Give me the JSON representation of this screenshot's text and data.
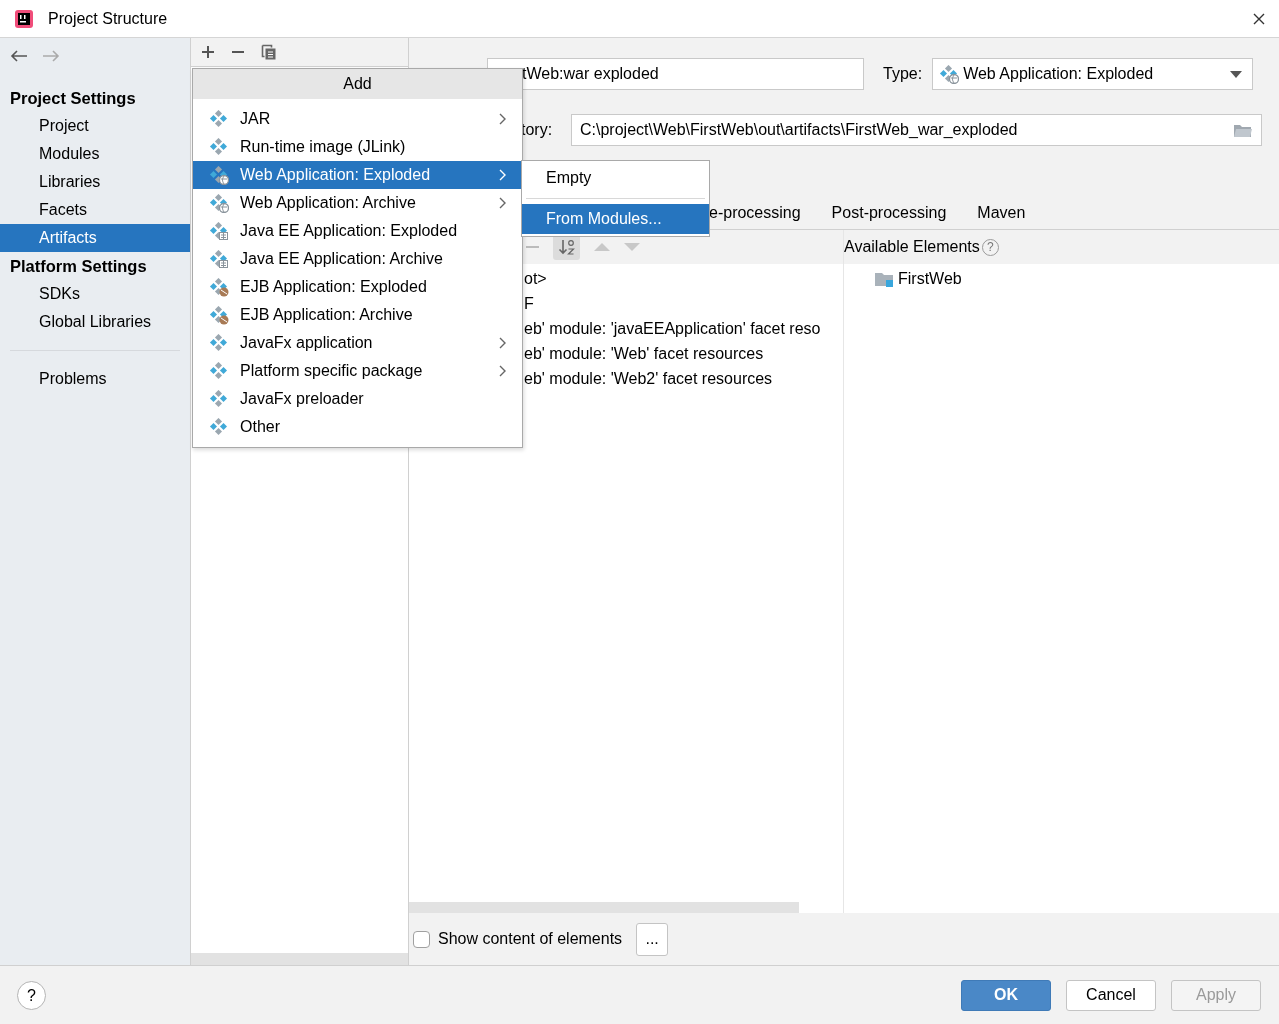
{
  "window": {
    "title": "Project Structure"
  },
  "sidebar": {
    "sections": [
      {
        "heading": "Project Settings",
        "items": [
          {
            "label": "Project",
            "selected": false
          },
          {
            "label": "Modules",
            "selected": false
          },
          {
            "label": "Libraries",
            "selected": false
          },
          {
            "label": "Facets",
            "selected": false
          },
          {
            "label": "Artifacts",
            "selected": true
          }
        ]
      },
      {
        "heading": "Platform Settings",
        "items": [
          {
            "label": "SDKs",
            "selected": false
          },
          {
            "label": "Global Libraries",
            "selected": false
          }
        ]
      }
    ],
    "extra_items": [
      {
        "label": "Problems",
        "selected": false
      }
    ]
  },
  "artifact": {
    "name_value": "tWeb:war exploded",
    "type_label": "Type:",
    "type_value": "Web Application: Exploded",
    "output_label": "tory:",
    "output_value": "C:\\project\\Web\\FirstWeb\\out\\artifacts\\FirstWeb_war_exploded"
  },
  "tabs": [
    {
      "label": "e-processing"
    },
    {
      "label": "Post-processing"
    },
    {
      "label": "Maven"
    }
  ],
  "output_tree": [
    "ot>",
    "F",
    "eb' module: 'javaEEApplication' facet reso",
    "eb' module: 'Web' facet resources",
    "eb' module: 'Web2' facet resources"
  ],
  "available_elements": {
    "title": "Available Elements",
    "help": "?",
    "items": [
      {
        "label": "FirstWeb"
      }
    ]
  },
  "show_content": {
    "label": "Show content of elements",
    "checked": false
  },
  "more_button": "...",
  "add_menu": {
    "title": "Add",
    "items": [
      {
        "label": "JAR",
        "kind": "plain",
        "has_submenu": true,
        "selected": false
      },
      {
        "label": "Run-time image (JLink)",
        "kind": "plain",
        "has_submenu": false,
        "selected": false
      },
      {
        "label": "Web Application: Exploded",
        "kind": "web",
        "has_submenu": true,
        "selected": true
      },
      {
        "label": "Web Application: Archive",
        "kind": "web",
        "has_submenu": true,
        "selected": false
      },
      {
        "label": "Java EE Application: Exploded",
        "kind": "ee",
        "has_submenu": false,
        "selected": false
      },
      {
        "label": "Java EE Application: Archive",
        "kind": "ee",
        "has_submenu": false,
        "selected": false
      },
      {
        "label": "EJB Application: Exploded",
        "kind": "ejb",
        "has_submenu": false,
        "selected": false
      },
      {
        "label": "EJB Application: Archive",
        "kind": "ejb",
        "has_submenu": false,
        "selected": false
      },
      {
        "label": "JavaFx application",
        "kind": "plain",
        "has_submenu": true,
        "selected": false
      },
      {
        "label": "Platform specific package",
        "kind": "plain",
        "has_submenu": true,
        "selected": false
      },
      {
        "label": "JavaFx preloader",
        "kind": "plain",
        "has_submenu": false,
        "selected": false
      },
      {
        "label": "Other",
        "kind": "plain",
        "has_submenu": false,
        "selected": false
      }
    ]
  },
  "submenu": {
    "items": [
      {
        "label": "Empty",
        "selected": false
      },
      {
        "label": "From Modules...",
        "selected": true
      }
    ]
  },
  "help_button": "?",
  "buttons": [
    {
      "label": "OK",
      "kind": "primary",
      "disabled": false
    },
    {
      "label": "Cancel",
      "kind": "default",
      "disabled": false
    },
    {
      "label": "Apply",
      "kind": "default",
      "disabled": true
    }
  ]
}
